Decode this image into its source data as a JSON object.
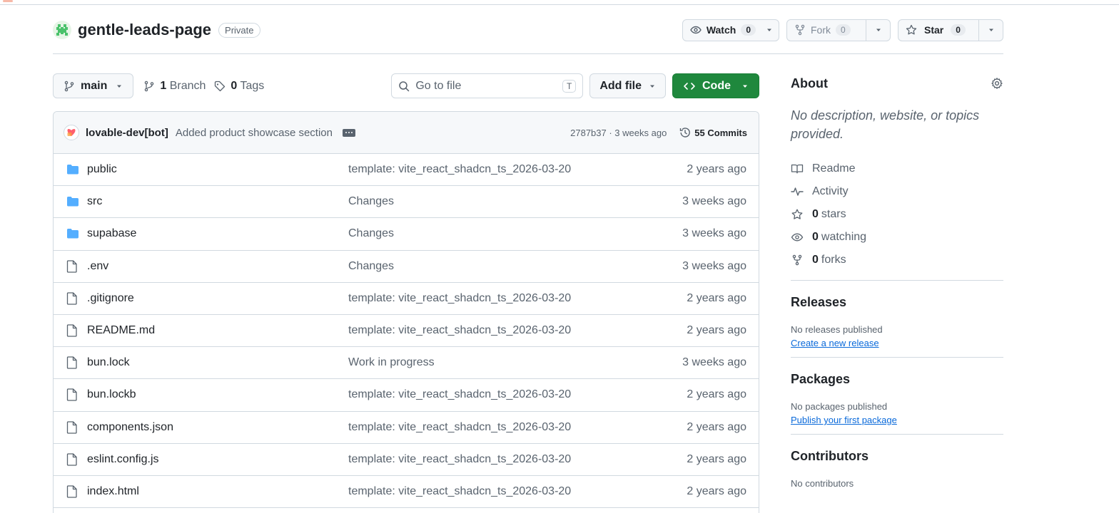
{
  "repo": {
    "name": "gentle-leads-page",
    "visibility": "Private"
  },
  "header_actions": {
    "watch": {
      "label": "Watch",
      "count": "0"
    },
    "fork": {
      "label": "Fork",
      "count": "0"
    },
    "star": {
      "label": "Star",
      "count": "0"
    }
  },
  "toolbar": {
    "branch": "main",
    "branch_count": "1",
    "branch_label": "Branch",
    "tag_count": "0",
    "tag_label": "Tags",
    "search_placeholder": "Go to file",
    "search_shortcut": "T",
    "add_file_label": "Add file",
    "code_label": "Code"
  },
  "latest_commit": {
    "author": "lovable-dev[bot]",
    "message": "Added product showcase section",
    "meta": "2787b37 · 3 weeks ago",
    "commits": "55 Commits"
  },
  "files": [
    {
      "name": "public",
      "type": "folder",
      "message": "template: vite_react_shadcn_ts_2026-03-20",
      "time": "2 years ago"
    },
    {
      "name": "src",
      "type": "folder",
      "message": "Changes",
      "time": "3 weeks ago"
    },
    {
      "name": "supabase",
      "type": "folder",
      "message": "Changes",
      "time": "3 weeks ago"
    },
    {
      "name": ".env",
      "type": "file",
      "message": "Changes",
      "time": "3 weeks ago"
    },
    {
      "name": ".gitignore",
      "type": "file",
      "message": "template: vite_react_shadcn_ts_2026-03-20",
      "time": "2 years ago"
    },
    {
      "name": "README.md",
      "type": "file",
      "message": "template: vite_react_shadcn_ts_2026-03-20",
      "time": "2 years ago"
    },
    {
      "name": "bun.lock",
      "type": "file",
      "message": "Work in progress",
      "time": "3 weeks ago"
    },
    {
      "name": "bun.lockb",
      "type": "file",
      "message": "template: vite_react_shadcn_ts_2026-03-20",
      "time": "2 years ago"
    },
    {
      "name": "components.json",
      "type": "file",
      "message": "template: vite_react_shadcn_ts_2026-03-20",
      "time": "2 years ago"
    },
    {
      "name": "eslint.config.js",
      "type": "file",
      "message": "template: vite_react_shadcn_ts_2026-03-20",
      "time": "2 years ago"
    },
    {
      "name": "index.html",
      "type": "file",
      "message": "template: vite_react_shadcn_ts_2026-03-20",
      "time": "2 years ago"
    }
  ],
  "about": {
    "title": "About",
    "description": "No description, website, or topics provided.",
    "readme": "Readme",
    "activity": "Activity",
    "stars_count": "0",
    "stars_label": "stars",
    "watching_count": "0",
    "watching_label": "watching",
    "forks_count": "0",
    "forks_label": "forks"
  },
  "releases": {
    "title": "Releases",
    "note": "No releases published",
    "link": "Create a new release"
  },
  "packages": {
    "title": "Packages",
    "note": "No packages published",
    "link": "Publish your first package"
  },
  "contributors": {
    "title": "Contributors",
    "note": "No contributors"
  },
  "colors": {
    "accent_green": "#1f883d",
    "link_blue": "#0969da",
    "folder_blue": "#54aeff"
  }
}
